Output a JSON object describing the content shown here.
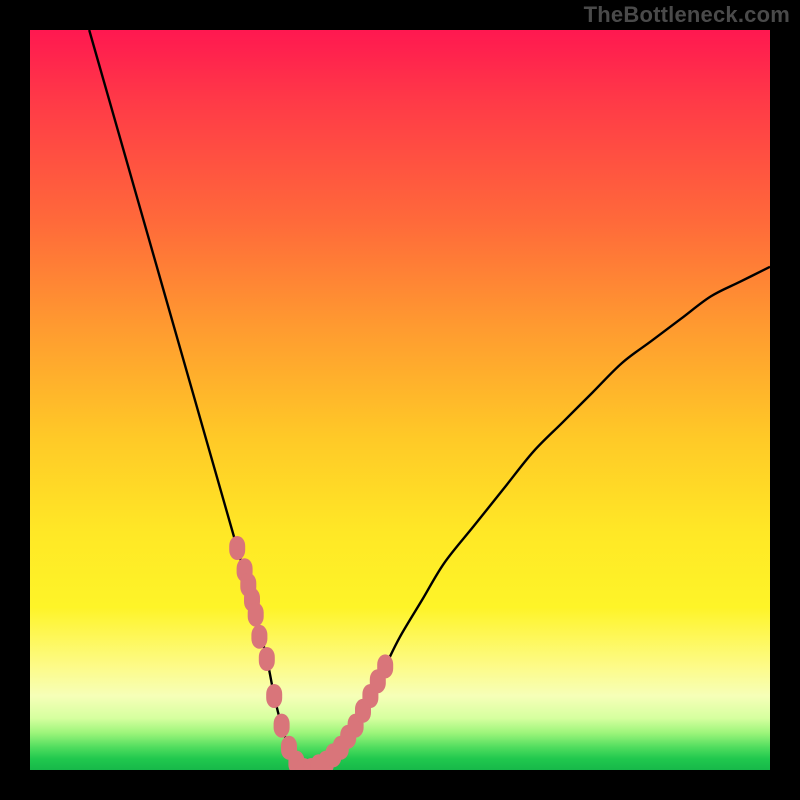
{
  "watermark": "TheBottleneck.com",
  "colors": {
    "frame": "#000000",
    "curve": "#000000",
    "marker": "#d9757a",
    "gradient_top": "#ff1850",
    "gradient_bottom": "#17b849"
  },
  "chart_data": {
    "type": "line",
    "title": "",
    "xlabel": "",
    "ylabel": "",
    "xlim": [
      0,
      100
    ],
    "ylim": [
      0,
      100
    ],
    "grid": false,
    "legend": false,
    "annotations": [
      "TheBottleneck.com"
    ],
    "series": [
      {
        "name": "bottleneck-curve",
        "x": [
          8,
          10,
          12,
          14,
          16,
          18,
          20,
          22,
          24,
          26,
          28,
          30,
          32,
          33,
          34,
          35,
          36,
          37,
          38,
          40,
          42,
          44,
          46,
          48,
          50,
          53,
          56,
          60,
          64,
          68,
          72,
          76,
          80,
          84,
          88,
          92,
          96,
          100
        ],
        "y": [
          100,
          93,
          86,
          79,
          72,
          65,
          58,
          51,
          44,
          37,
          30,
          23,
          15,
          10,
          6,
          3,
          1,
          0,
          0,
          1,
          3,
          6,
          10,
          14,
          18,
          23,
          28,
          33,
          38,
          43,
          47,
          51,
          55,
          58,
          61,
          64,
          66,
          68
        ]
      }
    ],
    "markers": {
      "name": "highlighted-points",
      "x": [
        28,
        29,
        29.5,
        30,
        30.5,
        31,
        32,
        33,
        34,
        35,
        36,
        37,
        38,
        39,
        40,
        41,
        42,
        43,
        44,
        45,
        46,
        47,
        48
      ],
      "y": [
        30,
        27,
        25,
        23,
        21,
        18,
        15,
        10,
        6,
        3,
        1,
        0,
        0,
        0.5,
        1,
        2,
        3,
        4.5,
        6,
        8,
        10,
        12,
        14
      ]
    }
  }
}
